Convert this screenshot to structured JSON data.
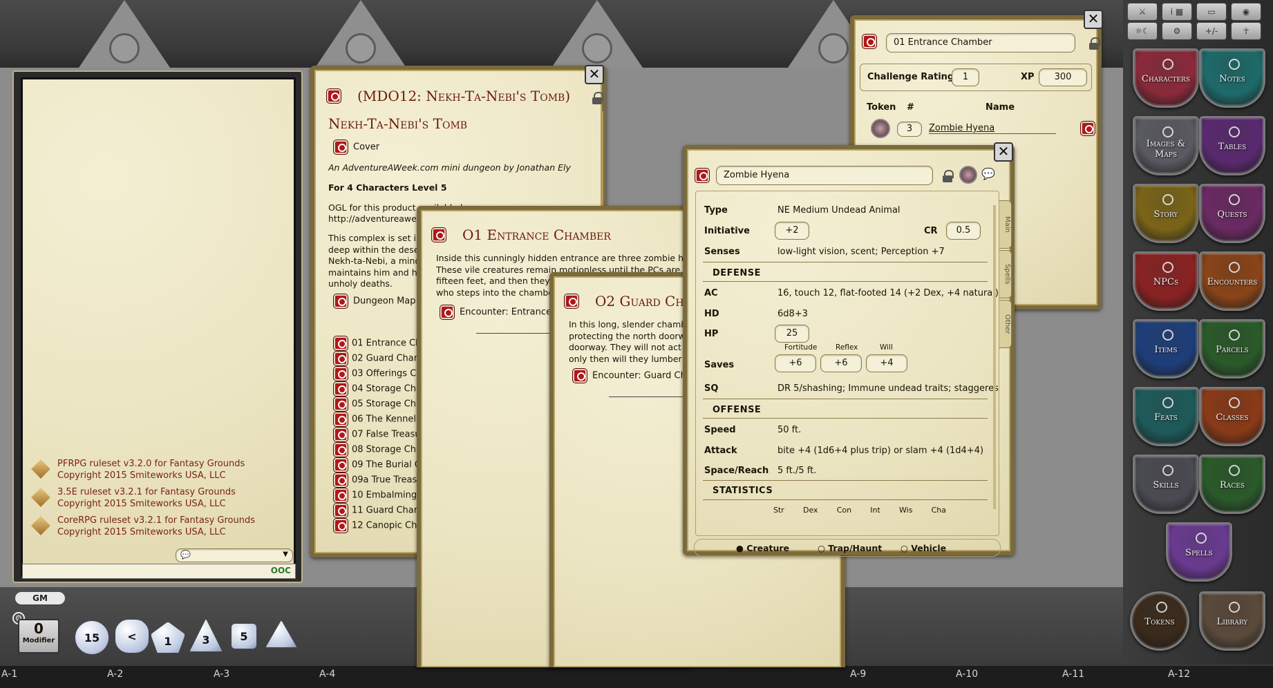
{
  "chat": {
    "modules": [
      {
        "line1": "PFRPG ruleset v3.2.0 for Fantasy Grounds",
        "line2": "Copyright 2015 Smiteworks USA, LLC"
      },
      {
        "line1": "3.5E ruleset v3.2.1 for Fantasy Grounds",
        "line2": "Copyright 2015 Smiteworks USA, LLC"
      },
      {
        "line1": "CoreRPG ruleset v3.2.1 for Fantasy Grounds",
        "line2": "Copyright 2015 Smiteworks USA, LLC"
      }
    ],
    "ooc_label": "OOC"
  },
  "bottom": {
    "gm_label": "GM",
    "modifier_value": "0",
    "modifier_label": "Modifier",
    "dice": [
      "d20",
      "d12",
      "d10",
      "d8",
      "d6",
      "d4"
    ],
    "dice_faces": [
      "15",
      "<",
      "1",
      "3",
      "5",
      ""
    ]
  },
  "grid_labels": [
    "A-1",
    "A-2",
    "A-3",
    "A-4",
    "A-9",
    "A-10",
    "A-11",
    "A-12"
  ],
  "module_window": {
    "title": "(MDO12: Nekh-Ta-Nebi's Tomb)",
    "heading": "Nekh-Ta-Nebi's Tomb",
    "cover": "Cover",
    "byline": "An AdventureAWeek.com mini dungeon by Jonathan Ely",
    "party": "For 4 Characters Level 5",
    "ogl1": "OGL for this product available here:",
    "ogl2": "http://adventureawee",
    "intro": [
      "This complex is set in",
      "deep within the dese",
      "Nekh-ta-Nebi, a minor",
      "maintains him and his",
      "unholy deaths."
    ],
    "map": "Dungeon Map",
    "rooms": [
      "01 Entrance Cha",
      "02 Guard Chamb",
      "03 Offerings Cha",
      "04 Storage Cham",
      "05 Storage Cham",
      "06 The Kennels",
      "07 False Treasur",
      "08 Storage Cham",
      "09 The Burial Ch",
      "09a True Treasu",
      "10 Embalming C",
      "11 Guard Chamb",
      "12 Canopic Chan"
    ]
  },
  "story_01": {
    "title": "O1 Entrance Chamber",
    "text": [
      "Inside this cunningly hidden entrance are three zombie hye",
      "These vile creatures remain motionless until the PCs are wi",
      "fifteen feet, and then they'll",
      "who steps into the chamber"
    ],
    "link": "Encounter: Entrance C"
  },
  "story_02": {
    "title": "O2 Guard Ch",
    "text": [
      "In this long, slender chambe",
      "protecting the north doorw",
      "doorway. They will not act u",
      "only then will they lumber t"
    ],
    "link": "Encounter: Guard Char"
  },
  "encounter": {
    "name": "01 Entrance Chamber",
    "cr_label": "Challenge Rating",
    "cr": "1",
    "xp_label": "XP",
    "xp": "300",
    "col_token": "Token",
    "col_num": "#",
    "col_name": "Name",
    "row_count": "3",
    "row_name": "Zombie Hyena"
  },
  "npc": {
    "name": "Zombie Hyena",
    "tabs": [
      "Main",
      "Spells",
      "Other"
    ],
    "type_label": "Type",
    "type": "NE Medium Undead Animal",
    "init_label": "Initiative",
    "init": "+2",
    "cr_label": "CR",
    "cr": "0.5",
    "senses_label": "Senses",
    "senses": "low-light vision, scent; Perception +7",
    "defense": "DEFENSE",
    "ac_label": "AC",
    "ac": "16, touch 12, flat-footed 14 (+2 Dex, +4 natural)",
    "hd_label": "HD",
    "hd": "6d8+3",
    "hp_label": "HP",
    "hp": "25",
    "saves_label": "Saves",
    "fort_label": "Fortitude",
    "fort": "+6",
    "ref_label": "Reflex",
    "ref": "+6",
    "will_label": "Will",
    "will": "+4",
    "sq_label": "SQ",
    "sq": "DR 5/shashing; Immune undead traits; staggeres",
    "offense": "OFFENSE",
    "speed_label": "Speed",
    "speed": "50 ft.",
    "attack_label": "Attack",
    "attack": "bite +4 (1d6+4 plus trip) or slam +4 (1d4+4)",
    "space_label": "Space/Reach",
    "space": "5 ft./5 ft.",
    "statistics": "STATISTICS",
    "abilities": [
      "Str",
      "Dex",
      "Con",
      "Int",
      "Wis",
      "Cha"
    ],
    "kind_options": [
      "Creature",
      "Trap/Haunt",
      "Vehicle"
    ],
    "kind_selected": "Creature"
  },
  "toolbar": {
    "row1": [
      "⚔",
      "i ▦",
      "▭",
      "◉"
    ],
    "row2": [
      "☼☾",
      "⚙",
      "+/-",
      "☥"
    ]
  },
  "sidebar": [
    {
      "label": "Characters",
      "color": "#8a2a3a"
    },
    {
      "label": "Notes",
      "color": "#1e6a6a"
    },
    {
      "label": "Images & Maps",
      "color": "#5a5a62"
    },
    {
      "label": "Tables",
      "color": "#5a2a70"
    },
    {
      "label": "Story",
      "color": "#7a6418"
    },
    {
      "label": "Quests",
      "color": "#6a2a62"
    },
    {
      "label": "NPCs",
      "color": "#8a2222"
    },
    {
      "label": "Encounters",
      "color": "#8a4418"
    },
    {
      "label": "Items",
      "color": "#1e3e7a"
    },
    {
      "label": "Parcels",
      "color": "#2a5a2a"
    },
    {
      "label": "Feats",
      "color": "#1e5a5a"
    },
    {
      "label": "Classes",
      "color": "#8a3a18"
    },
    {
      "label": "Skills",
      "color": "#4a4a52"
    },
    {
      "label": "Races",
      "color": "#2a5a2a"
    },
    {
      "label": "Spells",
      "color": "#6a3a90"
    },
    {
      "label": "Tokens",
      "color": "#3a2a1a"
    },
    {
      "label": "Library",
      "color": "#5a4a3a"
    }
  ]
}
